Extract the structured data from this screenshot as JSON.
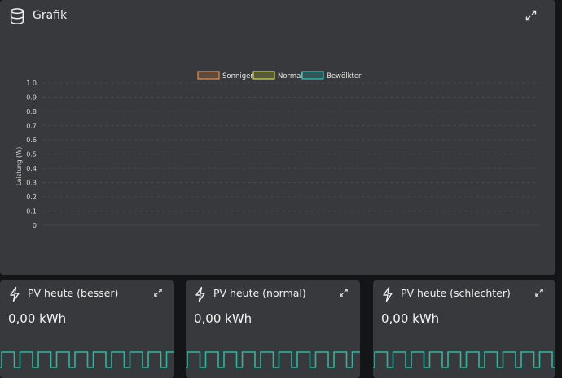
{
  "main": {
    "title": "Grafik",
    "icon": "database-icon",
    "expand_icon": "expand-icon"
  },
  "chart_data": {
    "type": "line",
    "ylabel": "Leistung (W)",
    "xlabel": "",
    "ylim": [
      0,
      1.0
    ],
    "yticks": [
      "1.0",
      "0.9",
      "0.8",
      "0.7",
      "0.6",
      "0.5",
      "0.4",
      "0.3",
      "0.2",
      "0.1",
      "0"
    ],
    "grid": true,
    "legend_position": "top",
    "series": [
      {
        "name": "Sonniger",
        "color": "#e8924a",
        "values": []
      },
      {
        "name": "Normal",
        "color": "#d6dc4a",
        "values": []
      },
      {
        "name": "Bewölkter",
        "color": "#2ec7bf",
        "values": []
      }
    ]
  },
  "tiles": [
    {
      "title": "PV heute (besser)",
      "value": "0,00 kWh"
    },
    {
      "title": "PV heute (normal)",
      "value": "0,00 kWh"
    },
    {
      "title": "PV heute (schlechter)",
      "value": "0,00 kWh"
    }
  ],
  "colors": {
    "card": "#38393c",
    "background": "#141517",
    "accent_wave": "#2ab9a0",
    "grid": "#4b4c50"
  }
}
